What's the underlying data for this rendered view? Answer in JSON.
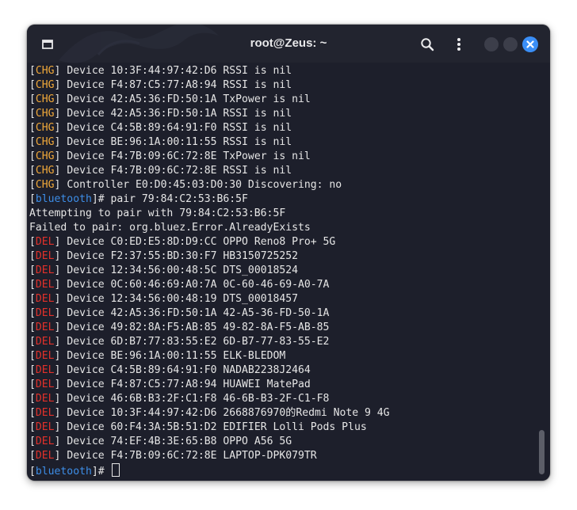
{
  "window": {
    "title": "root@Zeus: ~"
  },
  "icons": {
    "new_tab": "new-tab-icon",
    "search": "search-icon",
    "menu": "kebab-menu-icon",
    "minimize": "minimize-dot",
    "maximize": "maximize-dot",
    "close": "close-icon"
  },
  "colors": {
    "chg_tag": "#f0a83a",
    "del_tag": "#e0312b",
    "prompt": "#3d8ee8",
    "terminal_bg": "#1d1f2b",
    "close_button": "#3a8ef6"
  },
  "terminal": {
    "lines": [
      {
        "tag": "CHG",
        "text": " Device 10:3F:44:97:42:D6 RSSI is nil"
      },
      {
        "tag": "CHG",
        "text": " Device F4:87:C5:77:A8:94 RSSI is nil"
      },
      {
        "tag": "CHG",
        "text": " Device 42:A5:36:FD:50:1A TxPower is nil"
      },
      {
        "tag": "CHG",
        "text": " Device 42:A5:36:FD:50:1A RSSI is nil"
      },
      {
        "tag": "CHG",
        "text": " Device C4:5B:89:64:91:F0 RSSI is nil"
      },
      {
        "tag": "CHG",
        "text": " Device BE:96:1A:00:11:55 RSSI is nil"
      },
      {
        "tag": "CHG",
        "text": " Device F4:7B:09:6C:72:8E TxPower is nil"
      },
      {
        "tag": "CHG",
        "text": " Device F4:7B:09:6C:72:8E RSSI is nil"
      },
      {
        "tag": "CHG",
        "text": " Controller E0:D0:45:03:D0:30 Discovering: no"
      },
      {
        "prompt": "bluetooth",
        "text": "# pair 79:84:C2:53:B6:5F"
      },
      {
        "text": "Attempting to pair with 79:84:C2:53:B6:5F"
      },
      {
        "text": "Failed to pair: org.bluez.Error.AlreadyExists"
      },
      {
        "tag": "DEL",
        "text": " Device C0:ED:E5:8D:D9:CC OPPO Reno8 Pro+ 5G"
      },
      {
        "tag": "DEL",
        "text": " Device F2:37:55:BD:30:F7 HB3150725252"
      },
      {
        "tag": "DEL",
        "text": " Device 12:34:56:00:48:5C DTS_00018524"
      },
      {
        "tag": "DEL",
        "text": " Device 0C:60:46:69:A0:7A 0C-60-46-69-A0-7A"
      },
      {
        "tag": "DEL",
        "text": " Device 12:34:56:00:48:19 DTS_00018457"
      },
      {
        "tag": "DEL",
        "text": " Device 42:A5:36:FD:50:1A 42-A5-36-FD-50-1A"
      },
      {
        "tag": "DEL",
        "text": " Device 49:82:8A:F5:AB:85 49-82-8A-F5-AB-85"
      },
      {
        "tag": "DEL",
        "text": " Device 6D:B7:77:83:55:E2 6D-B7-77-83-55-E2"
      },
      {
        "tag": "DEL",
        "text": " Device BE:96:1A:00:11:55 ELK-BLEDOM"
      },
      {
        "tag": "DEL",
        "text": " Device C4:5B:89:64:91:F0 NADAB2238J2464"
      },
      {
        "tag": "DEL",
        "text": " Device F4:87:C5:77:A8:94 HUAWEI MatePad"
      },
      {
        "tag": "DEL",
        "text": " Device 46:6B:B3:2F:C1:F8 46-6B-B3-2F-C1-F8"
      },
      {
        "tag": "DEL",
        "text": " Device 10:3F:44:97:42:D6 2668876970的Redmi Note 9 4G"
      },
      {
        "tag": "DEL",
        "text": " Device 60:F4:3A:5B:51:D2 EDIFIER Lolli Pods Plus"
      },
      {
        "tag": "DEL",
        "text": " Device 74:EF:4B:3E:65:B8 OPPO A56 5G"
      },
      {
        "tag": "DEL",
        "text": " Device F4:7B:09:6C:72:8E LAPTOP-DPK079TR"
      },
      {
        "prompt": "bluetooth",
        "text": "# ",
        "cursor": true
      }
    ]
  }
}
